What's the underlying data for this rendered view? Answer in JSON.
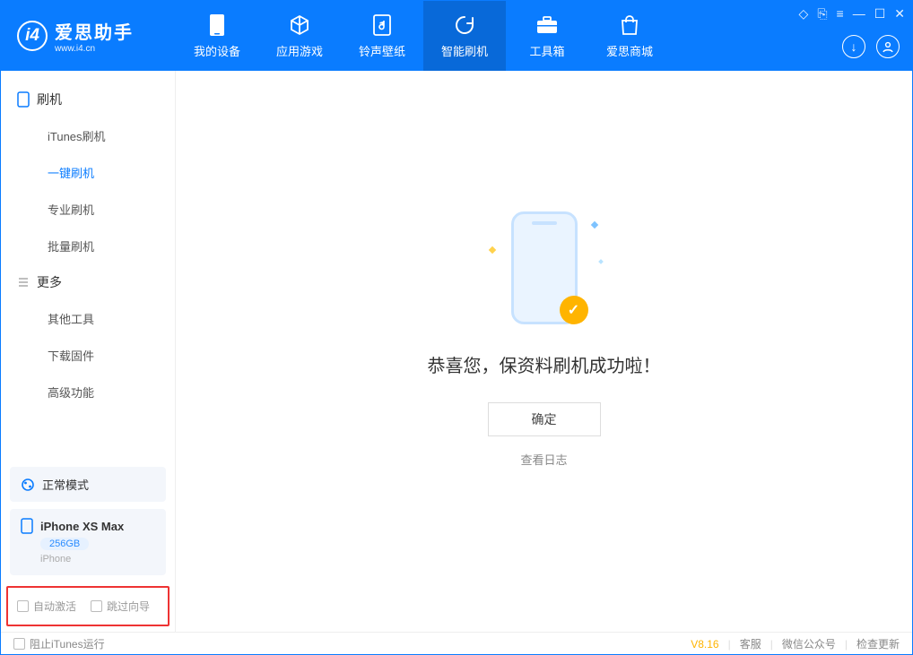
{
  "app": {
    "title": "爱思助手",
    "subtitle": "www.i4.cn"
  },
  "nav": {
    "tabs": [
      {
        "label": "我的设备"
      },
      {
        "label": "应用游戏"
      },
      {
        "label": "铃声壁纸"
      },
      {
        "label": "智能刷机"
      },
      {
        "label": "工具箱"
      },
      {
        "label": "爱思商城"
      }
    ],
    "active_index": 3
  },
  "sidebar": {
    "group1": {
      "title": "刷机",
      "items": [
        "iTunes刷机",
        "一键刷机",
        "专业刷机",
        "批量刷机"
      ],
      "active_index": 1
    },
    "group2": {
      "title": "更多",
      "items": [
        "其他工具",
        "下载固件",
        "高级功能"
      ]
    }
  },
  "device": {
    "mode_label": "正常模式",
    "name": "iPhone XS Max",
    "storage": "256GB",
    "type": "iPhone"
  },
  "highlight_opts": {
    "auto_activate": "自动激活",
    "skip_guide": "跳过向导"
  },
  "main": {
    "success_message": "恭喜您，保资料刷机成功啦！",
    "ok_button": "确定",
    "view_log": "查看日志"
  },
  "footer": {
    "block_itunes": "阻止iTunes运行",
    "version": "V8.16",
    "links": [
      "客服",
      "微信公众号",
      "检查更新"
    ]
  }
}
